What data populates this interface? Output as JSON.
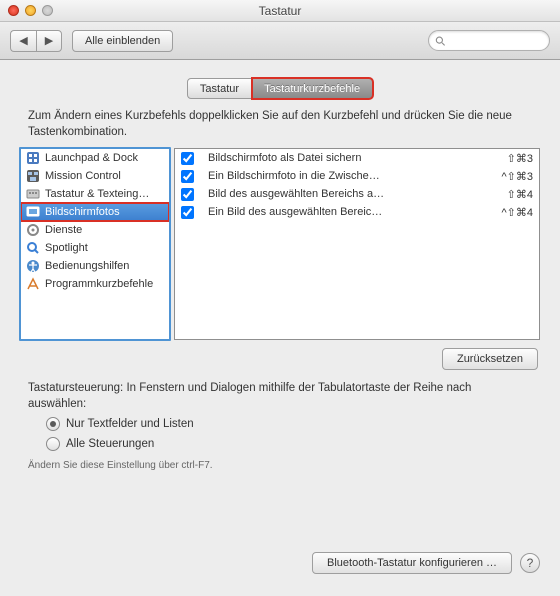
{
  "window": {
    "title": "Tastatur"
  },
  "toolbar": {
    "showall": "Alle einblenden"
  },
  "tabs": {
    "keyboard": "Tastatur",
    "shortcuts": "Tastaturkurzbefehle"
  },
  "description": "Zum Ändern eines Kurzbefehls doppelklicken Sie auf den Kurzbefehl und drücken Sie die neue Tastenkombination.",
  "categories": [
    {
      "name": "Launchpad & Dock"
    },
    {
      "name": "Mission Control"
    },
    {
      "name": "Tastatur & Texteing…"
    },
    {
      "name": "Bildschirmfotos"
    },
    {
      "name": "Dienste"
    },
    {
      "name": "Spotlight"
    },
    {
      "name": "Bedienungshilfen"
    },
    {
      "name": "Programmkurzbefehle"
    }
  ],
  "shortcuts": [
    {
      "label": "Bildschirmfoto als Datei sichern",
      "keys": "⇧⌘3"
    },
    {
      "label": "Ein Bildschirmfoto in die Zwische…",
      "keys": "^⇧⌘3"
    },
    {
      "label": "Bild des ausgewählten Bereichs a…",
      "keys": "⇧⌘4"
    },
    {
      "label": "Ein Bild des ausgewählten Bereic…",
      "keys": "^⇧⌘4"
    }
  ],
  "buttons": {
    "reset": "Zurücksetzen",
    "bluetooth": "Bluetooth-Tastatur konfigurieren …"
  },
  "kbnav": {
    "desc": "Tastatursteuerung: In Fenstern und Dialogen mithilfe der Tabulatortaste der Reihe nach auswählen:",
    "opt1": "Nur Textfelder und Listen",
    "opt2": "Alle Steuerungen",
    "hint": "Ändern Sie diese Einstellung über ctrl-F7."
  }
}
